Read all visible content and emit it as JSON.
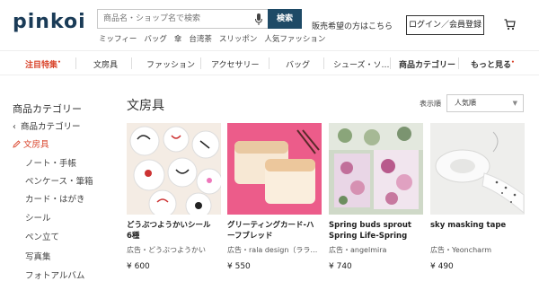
{
  "header": {
    "logo": "pinkoi",
    "search_placeholder": "商品名・ショップ名で検索",
    "search_button": "検索",
    "hot_tags": [
      "ミッフィー",
      "バッグ",
      "傘",
      "台湾茶",
      "スリッポン",
      "人気ファッション"
    ],
    "seller_link": "販売希望の方はこちら",
    "login_button": "ログイン／会員登録",
    "cart_icon": "cart-icon",
    "mic_icon": "mic-icon"
  },
  "nav": {
    "items": [
      {
        "label": "注目特集",
        "style": "accent",
        "sup": "•"
      },
      {
        "label": "文房具",
        "style": "normal"
      },
      {
        "label": "ファッション",
        "style": "normal"
      },
      {
        "label": "アクセサリー",
        "style": "normal"
      },
      {
        "label": "バッグ",
        "style": "normal"
      },
      {
        "label": "シューズ・ソ…",
        "style": "normal"
      },
      {
        "label": "商品カテゴリー",
        "style": "bold"
      },
      {
        "label": "もっと見る",
        "style": "bold",
        "sup": "•"
      }
    ]
  },
  "sidebar": {
    "title": "商品カテゴリー",
    "back_label": "商品カテゴリー",
    "active_label": "文房具",
    "sub_items": [
      "ノート・手帳",
      "ペンケース・筆箱",
      "カード・はがき",
      "シール",
      "ペン立て",
      "写真集",
      "フォトアルバム"
    ]
  },
  "main": {
    "title": "文房具",
    "sort_label": "表示順",
    "sort_value": "人気順",
    "products": [
      {
        "name": "どうぶつようかいシール　6種",
        "shop": "広告・どうぶつようかい",
        "price": "¥ 600"
      },
      {
        "name": "グリーティングカード-ハーフブレッド",
        "shop": "広告・rala design（ララ…",
        "price": "¥ 550"
      },
      {
        "name": "Spring buds sprout Spring Life-Spring them…",
        "shop": "広告・angelmira",
        "price": "¥ 740"
      },
      {
        "name": "sky masking tape",
        "shop": "広告・Yeoncharm",
        "price": "¥ 490"
      }
    ]
  },
  "colors": {
    "accent": "#d9442b",
    "brand": "#1a3b57",
    "search_button": "#1e4a66"
  }
}
